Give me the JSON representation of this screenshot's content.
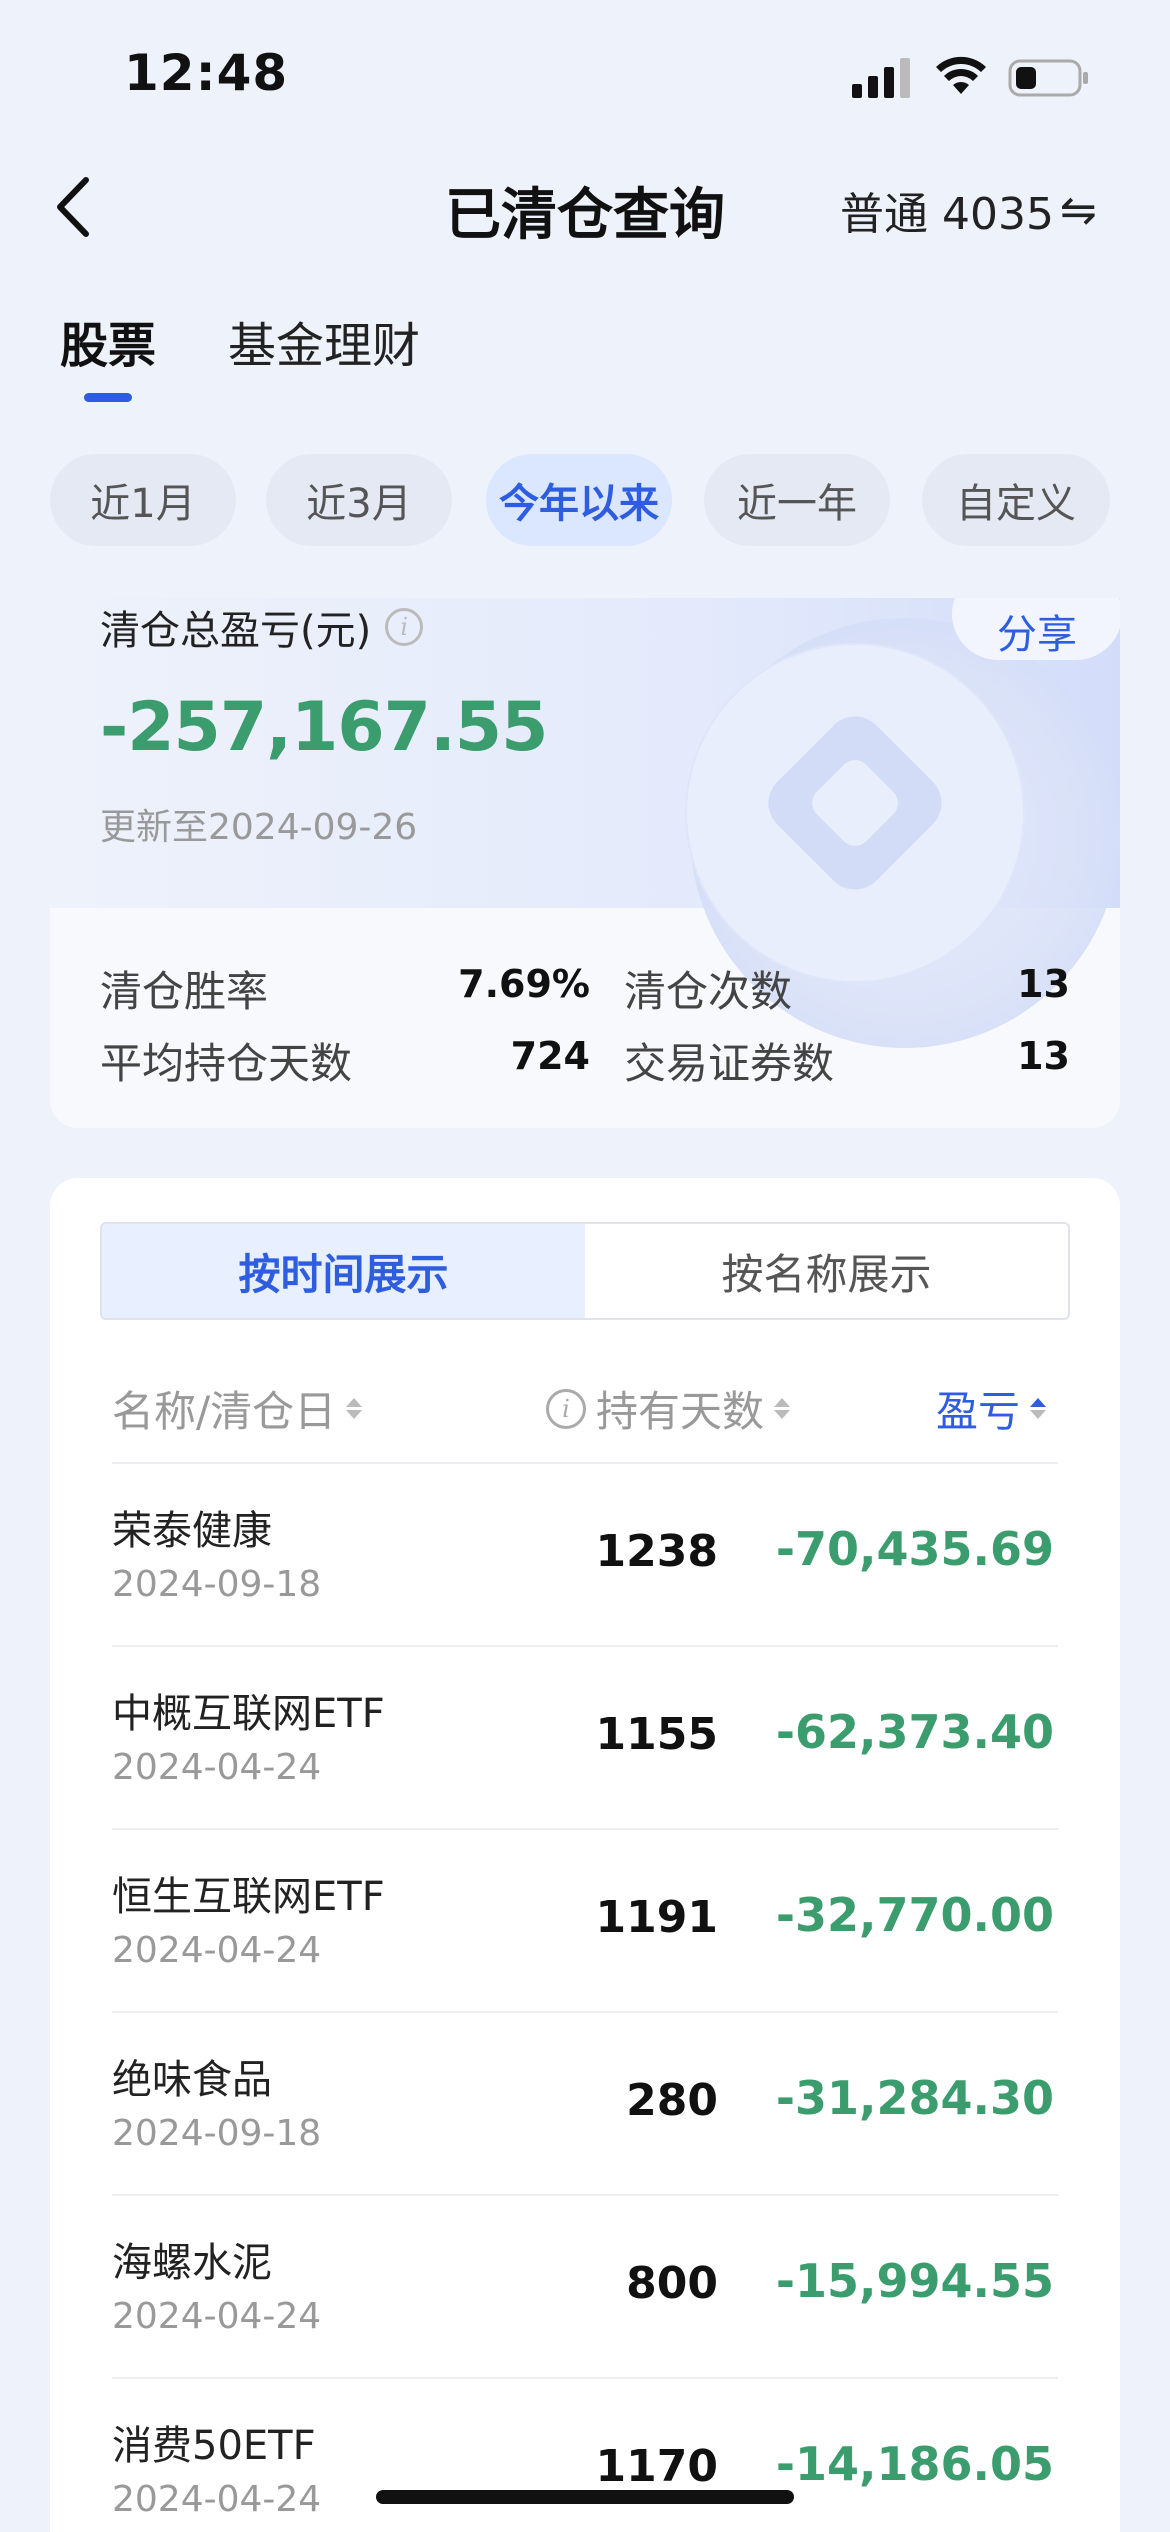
{
  "status_bar": {
    "time": "12:48"
  },
  "nav": {
    "title": "已清仓查询",
    "account": "普通 4035",
    "swap_icon": "⇋"
  },
  "tabs": [
    {
      "label": "股票",
      "active": true
    },
    {
      "label": "基金理财",
      "active": false
    }
  ],
  "filters": [
    {
      "label": "近1月",
      "active": false
    },
    {
      "label": "近3月",
      "active": false
    },
    {
      "label": "今年以来",
      "active": true
    },
    {
      "label": "近一年",
      "active": false
    },
    {
      "label": "自定义",
      "active": false
    }
  ],
  "summary": {
    "title": "清仓总盈亏(元)",
    "share_label": "分享",
    "total": "-257,167.55",
    "updated": "更新至2024-09-26",
    "stats": [
      {
        "label": "清仓胜率",
        "value": "7.69%"
      },
      {
        "label": "清仓次数",
        "value": "13"
      },
      {
        "label": "平均持仓天数",
        "value": "724"
      },
      {
        "label": "交易证券数",
        "value": "13"
      }
    ]
  },
  "view_toggle": {
    "by_time": "按时间展示",
    "by_name": "按名称展示"
  },
  "columns": {
    "name": "名称/清仓日",
    "days": "持有天数",
    "pnl": "盈亏"
  },
  "rows": [
    {
      "name": "荣泰健康",
      "date": "2024-09-18",
      "days": "1238",
      "pnl": "-70,435.69"
    },
    {
      "name": "中概互联网ETF",
      "date": "2024-04-24",
      "days": "1155",
      "pnl": "-62,373.40"
    },
    {
      "name": "恒生互联网ETF",
      "date": "2024-04-24",
      "days": "1191",
      "pnl": "-32,770.00"
    },
    {
      "name": "绝味食品",
      "date": "2024-09-18",
      "days": "280",
      "pnl": "-31,284.30"
    },
    {
      "name": "海螺水泥",
      "date": "2024-04-24",
      "days": "800",
      "pnl": "-15,994.55"
    },
    {
      "name": "消费50ETF",
      "date": "2024-04-24",
      "days": "1170",
      "pnl": "-14,186.05"
    }
  ],
  "colors": {
    "accent": "#2f5de0",
    "loss_green": "#3b9c6e"
  }
}
